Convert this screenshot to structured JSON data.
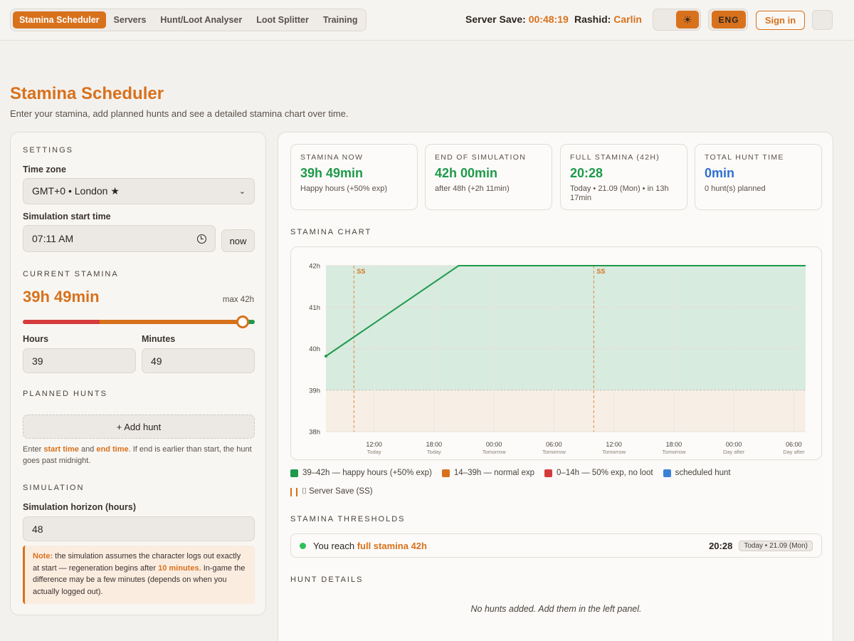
{
  "nav": {
    "items": [
      {
        "label": "Stamina Scheduler",
        "active": true,
        "name": "nav-stamina-scheduler"
      },
      {
        "label": "Servers",
        "active": false,
        "name": "nav-servers"
      },
      {
        "label": "Hunt/Loot Analyser",
        "active": false,
        "name": "nav-hunt-loot-analyser"
      },
      {
        "label": "Loot Splitter",
        "active": false,
        "name": "nav-loot-splitter"
      },
      {
        "label": "Training",
        "active": false,
        "name": "nav-training"
      }
    ]
  },
  "header": {
    "server_save_label": "Server Save:",
    "server_save_value": "00:48:19",
    "rashid_label": "Rashid:",
    "rashid_value": "Carlin",
    "theme_icon": "sun-icon",
    "lang": "ENG",
    "signin": "Sign in"
  },
  "page": {
    "title": "Stamina Scheduler",
    "subtitle": "Enter your stamina, add planned hunts and see a detailed stamina chart over time."
  },
  "settings": {
    "section": "SETTINGS",
    "timezone_label": "Time zone",
    "timezone_value": "GMT+0 • London ★",
    "start_label": "Simulation start time",
    "start_value": "07:11 AM",
    "now_label": "now"
  },
  "current": {
    "section": "CURRENT STAMINA",
    "value": "39h 49min",
    "max": "max 42h",
    "slider_fraction": 0.948,
    "hours_label": "Hours",
    "hours_value": "39",
    "minutes_label": "Minutes",
    "minutes_value": "49"
  },
  "planned": {
    "section": "PLANNED HUNTS",
    "add": "+ Add hunt",
    "hint_1": "Enter ",
    "hint_start": "start time",
    "hint_2": " and ",
    "hint_end": "end time",
    "hint_3": ". If end is earlier than start, the hunt goes past midnight."
  },
  "simulation": {
    "section": "SIMULATION",
    "horizon_label": "Simulation horizon (hours)",
    "horizon_value": "48",
    "note_label": "Note:",
    "note_1": " the simulation assumes the character logs out exactly at start — regeneration begins after ",
    "note_bold": "10 minutes",
    "note_2": ". In-game the difference may be a few minutes (depends on when you actually logged out)."
  },
  "cards": [
    {
      "title": "STAMINA NOW",
      "value": "39h 49min",
      "sub": "Happy hours (+50% exp)",
      "color": "#1e9a4a"
    },
    {
      "title": "END OF SIMULATION",
      "value": "42h 00min",
      "sub": "after 48h (+2h 11min)",
      "color": "#1e9a4a"
    },
    {
      "title": "FULL STAMINA (42H)",
      "value": "20:28",
      "sub": "Today • 21.09 (Mon) • in 13h 17min",
      "color": "#1e9a4a"
    },
    {
      "title": "TOTAL HUNT TIME",
      "value": "0min",
      "sub": "0 hunt(s) planned",
      "color": "#2f6fd0"
    }
  ],
  "chart_section": "STAMINA CHART",
  "chart_data": {
    "type": "line",
    "y_ticks": [
      "42h",
      "41h",
      "40h",
      "39h",
      "38h"
    ],
    "ylim": [
      38,
      42
    ],
    "x_ticks": [
      {
        "time": "12:00",
        "day": "Today"
      },
      {
        "time": "18:00",
        "day": "Today"
      },
      {
        "time": "00:00",
        "day": "Tomorrow"
      },
      {
        "time": "06:00",
        "day": "Tomorrow"
      },
      {
        "time": "12:00",
        "day": "Tomorrow"
      },
      {
        "time": "18:00",
        "day": "Tomorrow"
      },
      {
        "time": "00:00",
        "day": "Day after"
      },
      {
        "time": "06:00",
        "day": "Day after"
      }
    ],
    "xlim_hours": [
      0,
      48
    ],
    "series": [
      {
        "hours": [
          0,
          13.28,
          48
        ],
        "stamina": [
          39.82,
          42,
          42
        ],
        "color": "#1e9a4a"
      }
    ],
    "server_saves_hours": [
      2.8,
      26.8
    ],
    "server_save_label": "SS",
    "happy_zone": [
      39,
      42
    ],
    "happy_color": "#d7ebdf",
    "normal_color": "#f7efe6"
  },
  "legend": [
    {
      "label": "39–42h — happy hours (+50% exp)",
      "color": "#1e9a4a"
    },
    {
      "label": "14–39h — normal exp",
      "color": "#d8711c"
    },
    {
      "label": "0–14h — 50% exp, no loot",
      "color": "#d63b3b"
    },
    {
      "label": "scheduled hunt",
      "color": "#3b82d6"
    }
  ],
  "legend_ss": "⌷ Server Save (SS)",
  "thresholds": {
    "section": "STAMINA THRESHOLDS",
    "prefix": "You reach ",
    "bold": "full stamina 42h",
    "time": "20:28",
    "badge": "Today • 21.09 (Mon)"
  },
  "hunt_details": {
    "section": "HUNT DETAILS",
    "empty": "No hunts added. Add them in the left panel."
  }
}
